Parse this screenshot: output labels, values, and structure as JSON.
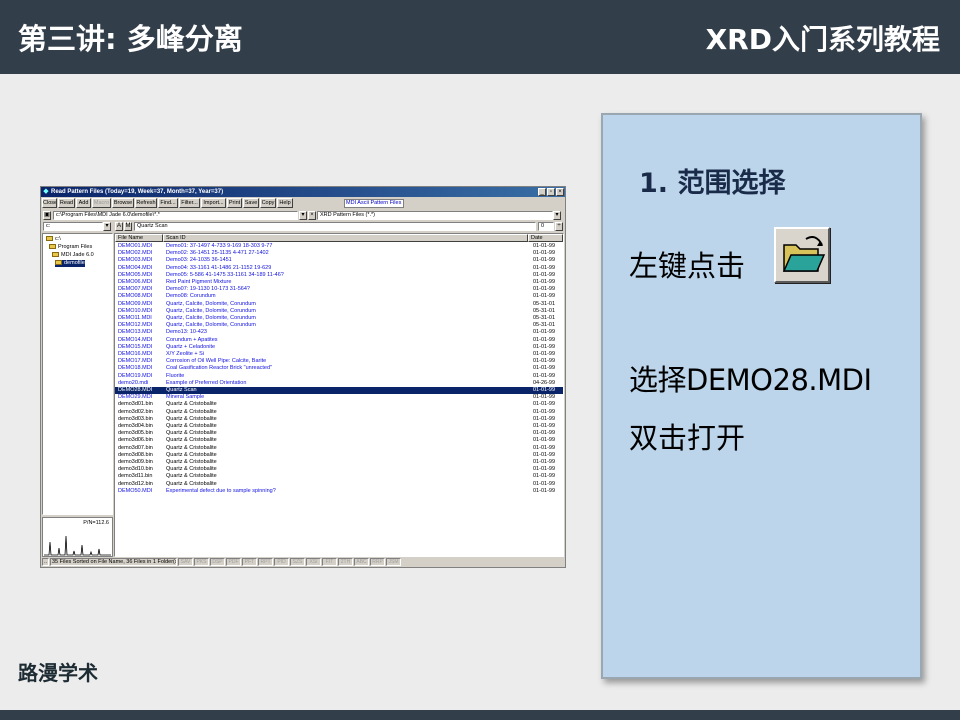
{
  "slide": {
    "header_left": "第三讲: 多峰分离",
    "header_right": "XRD入门系列教程",
    "footer_brand": "路漫学术"
  },
  "panel": {
    "step_title": "1. 范围选择",
    "line1": "左键点击",
    "line2": "选择DEMO28.MDI",
    "line3": "双击打开",
    "button_icon": "open-folder-icon"
  },
  "window": {
    "title": "Read Pattern Files (Today=19, Week=37, Month=37, Year=37)",
    "caption_buttons": [
      "_",
      "▫",
      "×"
    ],
    "toolbar": [
      "Close",
      "Read",
      "Add",
      "Macro",
      "Browse",
      "Refresh",
      "Find...",
      "Filter...",
      "Import...",
      "Print",
      "Save",
      "Copy",
      "Help"
    ],
    "toolbar_disabled": [
      "Macro"
    ],
    "file_type_label": "MDI Ascii Pattern Files",
    "path": "c:\\Program Files\\MDI Jade 6.0\\demofile\\*.*",
    "file_filter": "XRD Pattern Files (*.*)",
    "drive": "c:",
    "scan_filter": "Quartz Scan",
    "count_value": "0",
    "tree": [
      {
        "label": "c:\\",
        "selected": false
      },
      {
        "label": "Program Files",
        "selected": false
      },
      {
        "label": "MDI Jade 6.0",
        "selected": false
      },
      {
        "label": "demofile",
        "selected": true
      }
    ],
    "chart_label": "P/N=112.6",
    "columns": [
      "File Name",
      "Scan ID",
      "Date"
    ],
    "files": [
      {
        "name": "DEMO01.MDI",
        "scan": "Demo01: 37-1497 4-733 9-169 18-303 9-77",
        "date": "01-01-99",
        "style": "blue"
      },
      {
        "name": "DEMO02.MDI",
        "scan": "Demo02: 36-1451 25-1135 4-471 27-1402",
        "date": "01-01-99",
        "style": "blue"
      },
      {
        "name": "DEMO03.MDI",
        "scan": "Demo03: 24-1035 36-1451",
        "date": "01-01-99",
        "style": "blue"
      },
      {
        "name": "DEMO04.MDI",
        "scan": "Demo04: 33-1161 41-1486 21-1152 19-629",
        "date": "01-01-99",
        "style": "blue"
      },
      {
        "name": "DEMO05.MDI",
        "scan": "Demo05: 5-586 41-1475 33-1161 34-189 11-46?",
        "date": "01-01-99",
        "style": "blue"
      },
      {
        "name": "DEMO06.MDI",
        "scan": "Red Paint Pigment Mixture",
        "date": "01-01-99",
        "style": "blue"
      },
      {
        "name": "DEMO07.MDI",
        "scan": "Demo07: 19-1130 10-173 31-564?",
        "date": "01-01-99",
        "style": "blue"
      },
      {
        "name": "DEMO08.MDI",
        "scan": "Demo08: Corundum",
        "date": "01-01-99",
        "style": "blue"
      },
      {
        "name": "DEMO09.MDI",
        "scan": "Quartz, Calcite, Dolomite, Corundum",
        "date": "05-31-01",
        "style": "blue"
      },
      {
        "name": "DEMO10.MDI",
        "scan": "Quartz, Calcite, Dolomite, Corundum",
        "date": "05-31-01",
        "style": "blue"
      },
      {
        "name": "DEMO11.MDI",
        "scan": "Quartz, Calcite, Dolomite, Corundum",
        "date": "05-31-01",
        "style": "blue"
      },
      {
        "name": "DEMO12.MDI",
        "scan": "Quartz, Calcite, Dolomite, Corundum",
        "date": "05-31-01",
        "style": "blue"
      },
      {
        "name": "DEMO13.MDI",
        "scan": "Demo13: 10-423",
        "date": "01-01-99",
        "style": "blue"
      },
      {
        "name": "DEMO14.MDI",
        "scan": "Corundum + Apatites",
        "date": "01-01-99",
        "style": "blue"
      },
      {
        "name": "DEMO15.MDI",
        "scan": "Quartz + Celadonite",
        "date": "01-01-99",
        "style": "blue"
      },
      {
        "name": "DEMO16.MDI",
        "scan": "X/Y Zeolite + Si",
        "date": "01-01-99",
        "style": "blue"
      },
      {
        "name": "DEMO17.MDI",
        "scan": "Corrosion of Oil Well Pipe: Calcite, Barite",
        "date": "01-01-99",
        "style": "blue"
      },
      {
        "name": "DEMO18.MDI",
        "scan": "Coal Gasification Reactor Brick \"unreacted\"",
        "date": "01-01-99",
        "style": "blue"
      },
      {
        "name": "DEMO19.MDI",
        "scan": "Fluorite",
        "date": "01-01-99",
        "style": "blue"
      },
      {
        "name": "demo20.mdi",
        "scan": "Example of Preferred Orientation",
        "date": "04-26-99",
        "style": "blue"
      },
      {
        "name": "DEMO28.MDI",
        "scan": "Quartz Scan",
        "date": "01-01-99",
        "style": "sel"
      },
      {
        "name": "DEMO29.MDI",
        "scan": "Mineral Sample",
        "date": "01-01-99",
        "style": "blue"
      },
      {
        "name": "demo3d01.bin",
        "scan": "Quartz & Cristobalite",
        "date": "01-01-99",
        "style": "black"
      },
      {
        "name": "demo3d02.bin",
        "scan": "Quartz & Cristobalite",
        "date": "01-01-99",
        "style": "black"
      },
      {
        "name": "demo3d03.bin",
        "scan": "Quartz & Cristobalite",
        "date": "01-01-99",
        "style": "black"
      },
      {
        "name": "demo3d04.bin",
        "scan": "Quartz & Cristobalite",
        "date": "01-01-99",
        "style": "black"
      },
      {
        "name": "demo3d05.bin",
        "scan": "Quartz & Cristobalite",
        "date": "01-01-99",
        "style": "black"
      },
      {
        "name": "demo3d06.bin",
        "scan": "Quartz & Cristobalite",
        "date": "01-01-99",
        "style": "black"
      },
      {
        "name": "demo3d07.bin",
        "scan": "Quartz & Cristobalite",
        "date": "01-01-99",
        "style": "black"
      },
      {
        "name": "demo3d08.bin",
        "scan": "Quartz & Cristobalite",
        "date": "01-01-99",
        "style": "black"
      },
      {
        "name": "demo3d09.bin",
        "scan": "Quartz & Cristobalite",
        "date": "01-01-99",
        "style": "black"
      },
      {
        "name": "demo3d10.bin",
        "scan": "Quartz & Cristobalite",
        "date": "01-01-99",
        "style": "black"
      },
      {
        "name": "demo3d11.bin",
        "scan": "Quartz & Cristobalite",
        "date": "01-01-99",
        "style": "black"
      },
      {
        "name": "demo3d12.bin",
        "scan": "Quartz & Cristobalite",
        "date": "01-01-99",
        "style": "black"
      },
      {
        "name": "DEMO50.MDI",
        "scan": "Experimental defect due to sample spinning?",
        "date": "01-01-99",
        "style": "blue"
      }
    ],
    "status_text": "35 Files Sorted on File Name, 36 Files in 1 Folder(s)",
    "status_cells": [
      "SAV",
      "PKS",
      "DSP",
      "PDF",
      "PFT",
      "RPT",
      "PID",
      "SZS",
      "XSI",
      "FIT",
      "2TH",
      "ABC",
      "RRP",
      "JSM"
    ]
  }
}
